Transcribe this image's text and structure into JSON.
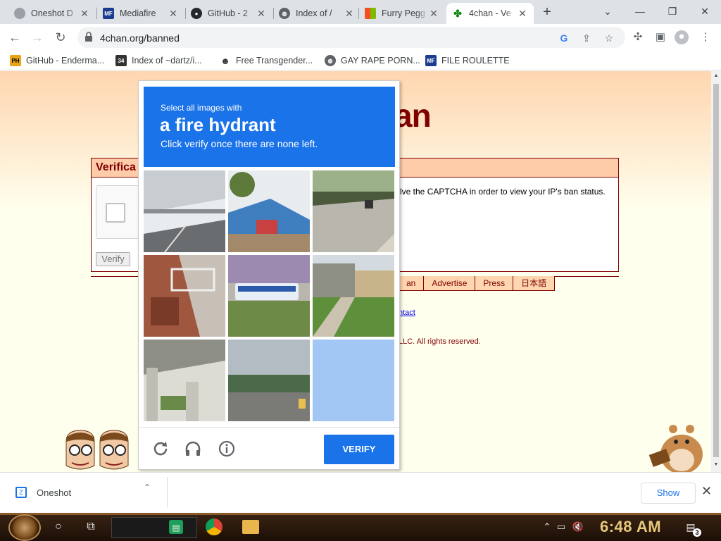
{
  "tabs": [
    {
      "title": "Oneshot D",
      "icon": "hexagon-icon",
      "active": false
    },
    {
      "title": "Mediafire",
      "icon": "mediafire-icon",
      "active": false
    },
    {
      "title": "GitHub - 2",
      "icon": "github-icon",
      "active": false
    },
    {
      "title": "Index of /",
      "icon": "globe-icon",
      "active": false
    },
    {
      "title": "Furry Pegg",
      "icon": "windows-logo-icon",
      "active": false
    },
    {
      "title": "4chan - Ve",
      "icon": "clover-icon",
      "active": true
    }
  ],
  "address_bar": {
    "url": "4chan.org/banned"
  },
  "bookmarks": [
    {
      "label": "GitHub - Enderma...",
      "icon": "ph-icon"
    },
    {
      "label": "Index of ~dartz/i...",
      "icon": "index-icon"
    },
    {
      "label": "Free Transgender...",
      "icon": "mask-icon"
    },
    {
      "label": "GAY RAPE PORN...",
      "icon": "globe-icon"
    },
    {
      "label": "FILE ROULETTE",
      "icon": "mediafire-icon"
    }
  ],
  "page": {
    "logo_fragment": "an",
    "box_title": "Verifica",
    "box_text": "lve the CAPTCHA in order to view your IP's ban status.",
    "verify_button": "Verify",
    "footer_links": [
      "an",
      "Advertise",
      "Press",
      "日本語"
    ],
    "contact": "ntact",
    "copyright": "LLC. All rights reserved."
  },
  "captcha": {
    "line1": "Select all images with",
    "line2": "a fire hydrant",
    "line3": "Click verify once there are none left.",
    "verify": "VERIFY",
    "tiles": [
      "overpass-highway",
      "market-stalls",
      "street-motorbike",
      "apartment-balcony",
      "bus-on-road",
      "houses-lawn",
      "under-bridge",
      "palm-road",
      "selected-blank"
    ]
  },
  "downloads": {
    "item": "Oneshot",
    "show_all": "Show"
  },
  "taskbar": {
    "time": "6:48 AM",
    "notification_count": "3"
  },
  "colors": {
    "captcha_blue": "#1a73e8",
    "page_maroon": "#800000",
    "page_bg": "#ffffee"
  }
}
